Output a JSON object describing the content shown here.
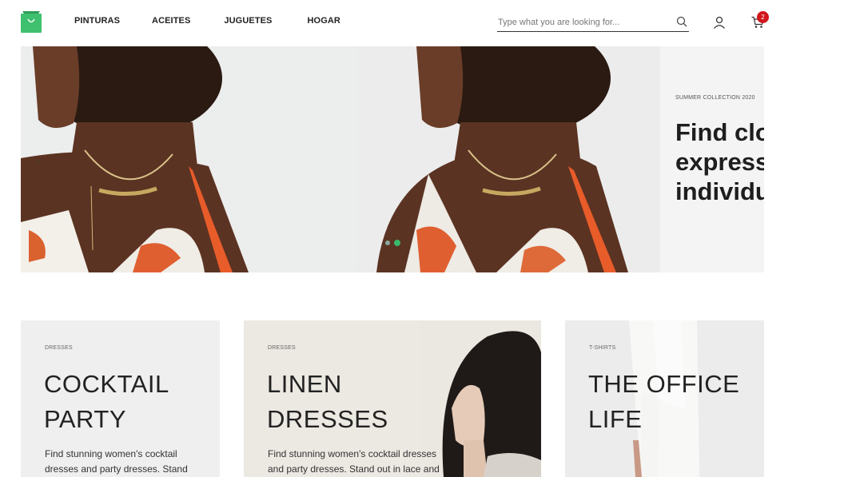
{
  "header": {
    "nav": [
      "PINTURAS",
      "ACEITES",
      "JUGUETES",
      "HOGAR"
    ],
    "search_placeholder": "Type what you are looking for...",
    "cart_count": "2"
  },
  "hero": {
    "eyebrow": "SUMMER COLLECTION 2020",
    "title_lines": [
      "Find clo",
      "express",
      "individu"
    ],
    "slides": 2,
    "active_slide": 2
  },
  "cards": [
    {
      "tag": "DRESSES",
      "title_lines": [
        "COCKTAIL",
        "PARTY"
      ],
      "description": "Find stunning women's cocktail dresses and party dresses. Stand"
    },
    {
      "tag": "DRESSES",
      "title_lines": [
        "LINEN",
        "DRESSES"
      ],
      "description": "Find stunning women's cocktail dresses and party dresses. Stand out in lace and"
    },
    {
      "tag": "T-SHIRTS",
      "title_lines": [
        "THE OFFICE",
        "LIFE"
      ],
      "description": ""
    }
  ],
  "colors": {
    "brand_green": "#3ab86a",
    "badge_red": "#d0161b",
    "hero_bg": "#ecedec",
    "card_bg_neutral": "#efefef",
    "card_bg_warm": "#ece8e2"
  }
}
